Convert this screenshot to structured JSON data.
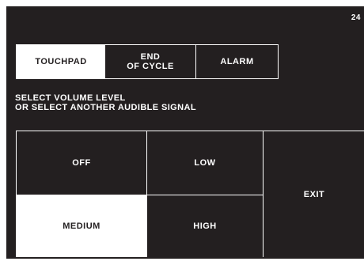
{
  "screen": {
    "page_number": "24",
    "background_color": "#231f20",
    "foreground_color": "#ffffff"
  },
  "tabs": [
    {
      "label": "TOUCHPAD",
      "selected": true
    },
    {
      "label": "END\nOF CYCLE",
      "selected": false
    },
    {
      "label": "ALARM",
      "selected": false
    }
  ],
  "instructions": {
    "line1": "SELECT VOLUME LEVEL",
    "line2": "OR SELECT ANOTHER AUDIBLE SIGNAL"
  },
  "volume_options": {
    "off": {
      "label": "OFF",
      "selected": false
    },
    "low": {
      "label": "LOW",
      "selected": false
    },
    "medium": {
      "label": "MEDIUM",
      "selected": true
    },
    "high": {
      "label": "HIGH",
      "selected": false
    }
  },
  "exit": {
    "label": "EXIT"
  }
}
